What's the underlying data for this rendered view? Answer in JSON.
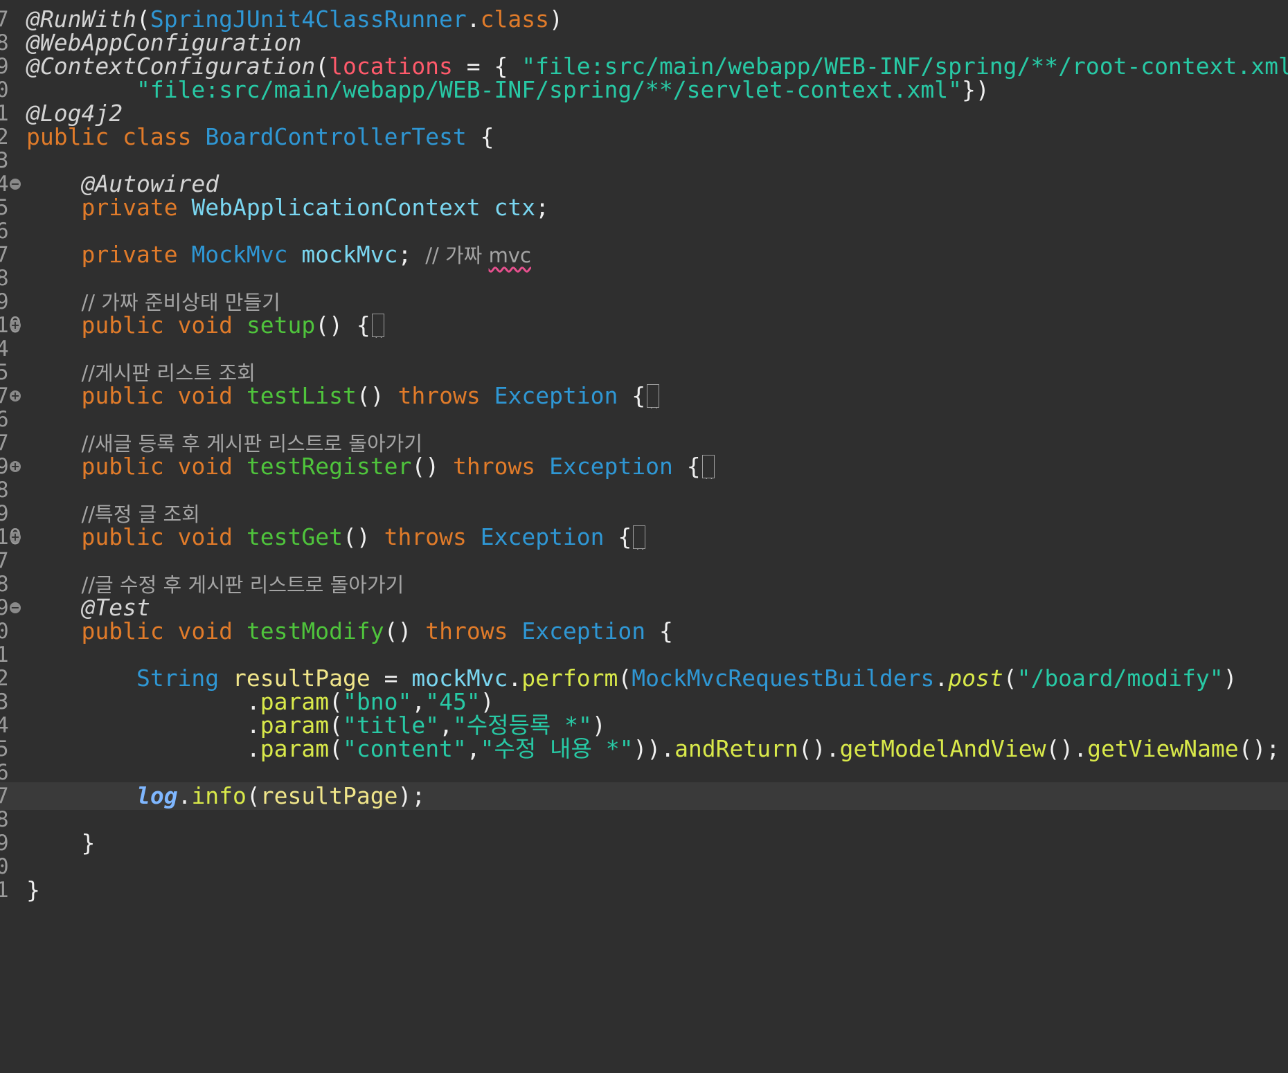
{
  "gutter": {
    "l1": "7",
    "l2": "8",
    "l3": "9",
    "l4": "0",
    "l5": "1",
    "l6": "2",
    "l7": "3",
    "l8": "4",
    "l9": "5",
    "l10": "6",
    "l11": "7",
    "l12": "8",
    "l13": "9",
    "l14": "10",
    "l15": "4",
    "l16": "5",
    "l17": "7",
    "l18": "6",
    "l19": "7",
    "l20": "9",
    "l21": "8",
    "l22": "9",
    "l23": "10",
    "l24": "7",
    "l25": "8",
    "l26": "9",
    "l27": "0",
    "l28": "1",
    "l29": "2",
    "l30": "3",
    "l31": "4",
    "l32": "5",
    "l33": "6",
    "l34": "7",
    "l35": "8",
    "l36": "9",
    "l37": "0",
    "l38": "1"
  },
  "tokens": {
    "runwith": "@RunWith",
    "runner_class": "SpringJUnit4ClassRunner",
    "dot": ".",
    "class_kw": "class",
    "webapp_cfg": "@WebAppConfiguration",
    "ctx_cfg": "@ContextConfiguration",
    "locations": "locations",
    "root_ctx": "\"file:src/main/webapp/WEB-INF/spring/**/root-context.xml\"",
    "servlet_ctx": "\"file:src/main/webapp/WEB-INF/spring/**/servlet-context.xml\"",
    "log4j2": "@Log4j2",
    "public": "public",
    "private": "private",
    "void": "void",
    "throws": "throws",
    "class_name": "BoardControllerTest",
    "autowired": "@Autowired",
    "wac_type": "WebApplicationContext",
    "ctx_var": "ctx",
    "mockmvc_type": "MockMvc",
    "mockmvc_var": "mockMvc",
    "comment_fake_prefix": "// 가짜 ",
    "comment_fake_mvc": "mvc",
    "comment_setup": "// 가짜 준비상태 만들기",
    "setup": "setup",
    "comment_list": "//게시판 리스트 조회",
    "testList": "testList",
    "exception": "Exception",
    "comment_register": "//새글 등록 후 게시판 리스트로 돌아가기",
    "testRegister": "testRegister",
    "comment_get": "//특정 글 조회",
    "testGet": "testGet",
    "comment_modify": "//글 수정 후 게시판 리스트로 돌아가기",
    "test_ann": "@Test",
    "testModify": "testModify",
    "string_type": "String",
    "resultPage": "resultPage",
    "perform": "perform",
    "builders": "MockMvcRequestBuilders",
    "post": "post",
    "url": "\"/board/modify\"",
    "param": "param",
    "bno_key": "\"bno\"",
    "bno_val": "\"45\"",
    "title_key": "\"title\"",
    "title_val": "\"수정등록 *\"",
    "content_key": "\"content\"",
    "content_val": "\"수정 내용 *\"",
    "andReturn": "andReturn",
    "getModelAndView": "getModelAndView",
    "getViewName": "getViewName",
    "log": "log",
    "info": "info"
  }
}
